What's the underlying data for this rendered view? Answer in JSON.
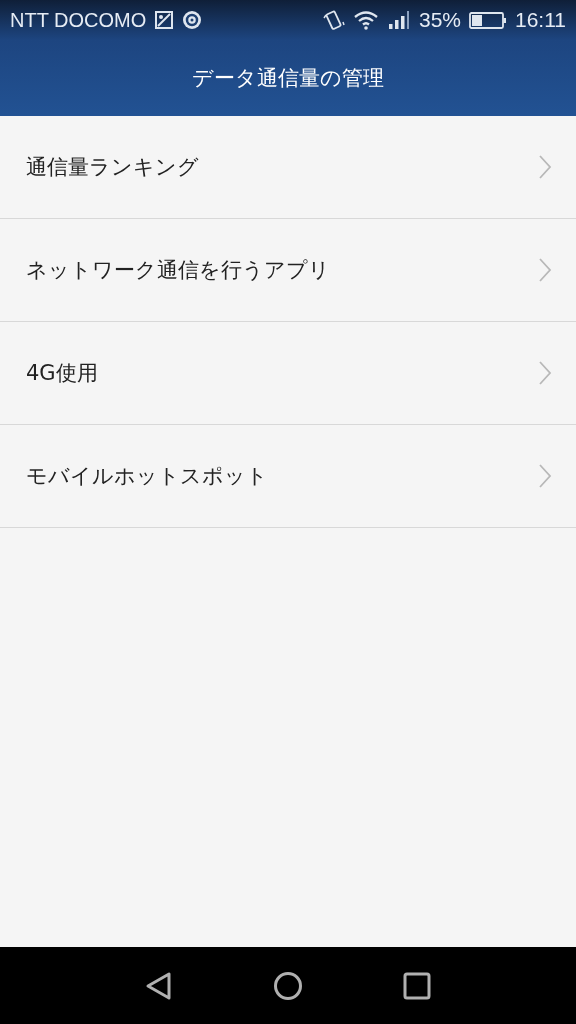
{
  "status_bar": {
    "carrier": "NTT DOCOMO",
    "battery_percent": "35%",
    "time": "16:11"
  },
  "header": {
    "title": "データ通信量の管理"
  },
  "menu": {
    "items": [
      {
        "label": "通信量ランキング"
      },
      {
        "label": "ネットワーク通信を行うアプリ"
      },
      {
        "label": "4G使用"
      },
      {
        "label": "モバイルホットスポット"
      }
    ]
  }
}
